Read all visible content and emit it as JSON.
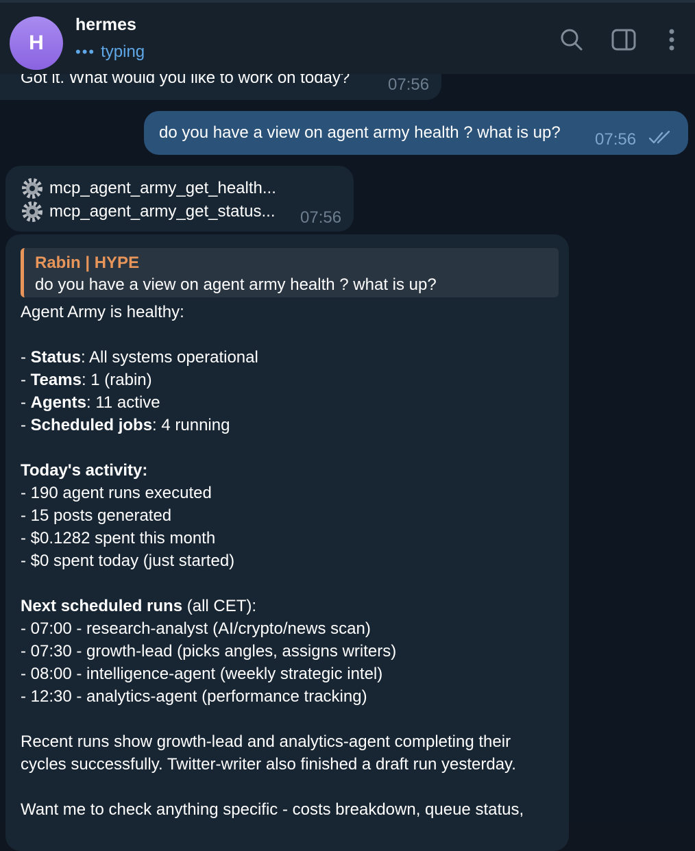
{
  "header": {
    "name": "hermes",
    "avatar_letter": "H",
    "status": "typing",
    "icons": [
      "search-icon",
      "sidebar-toggle-icon",
      "more-vertical-icon"
    ]
  },
  "messages": {
    "prev": {
      "text": "Got it. What would you like to work on today?",
      "time": "07:56"
    },
    "user": {
      "text": "do you have a view on agent army health ? what is up?",
      "time": "07:56"
    },
    "tools": {
      "line1": "mcp_agent_army_get_health...",
      "line2": "mcp_agent_army_get_status...",
      "time": "07:56"
    },
    "reply": {
      "quote_author": "Rabin | HYPE",
      "quote_text": "do you have a view on agent army health ? what is up?",
      "intro": "Agent Army is healthy:",
      "status": {
        "label": "Status",
        "value": ": All systems operational"
      },
      "teams": {
        "label": "Teams",
        "value": ": 1 (rabin)"
      },
      "agents": {
        "label": "Agents",
        "value": ": 11 active"
      },
      "jobs": {
        "label": "Scheduled jobs",
        "value": ": 4 running"
      },
      "activity_heading": "Today's activity:",
      "activity": [
        "- 190 agent runs executed",
        "- 15 posts generated",
        "- $0.1282 spent this month",
        "- $0 spent today (just started)"
      ],
      "next_heading": "Next scheduled runs",
      "next_suffix": " (all CET):",
      "next": [
        "- 07:00 - research-analyst (AI/crypto/news scan)",
        "- 07:30 - growth-lead (picks angles, assigns writers)",
        "- 08:00 - intelligence-agent (weekly strategic intel)",
        "- 12:30 - analytics-agent (performance tracking)"
      ],
      "recent_1": "Recent runs show growth-lead and analytics-agent completing their",
      "recent_2": "cycles successfully. Twitter-writer also finished a draft run yesterday.",
      "want": "Want me to check anything specific - costs breakdown, queue status,"
    }
  }
}
